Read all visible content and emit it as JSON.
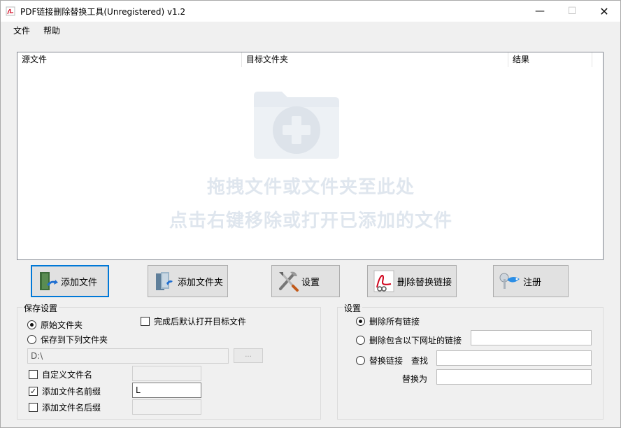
{
  "window": {
    "title": "PDF链接删除替换工具(Unregistered) v1.2",
    "controls": {
      "minimize": "—",
      "maximize": "☐",
      "close": "✕"
    }
  },
  "menu": {
    "file": "文件",
    "help": "帮助"
  },
  "filelist": {
    "columns": {
      "source": "源文件",
      "target": "目标文件夹",
      "result": "结果"
    },
    "hint_line1": "拖拽文件或文件夹至此处",
    "hint_line2": "点击右键移除或打开已添加的文件",
    "drop_icon": "folder-plus-icon"
  },
  "toolbar": {
    "add_file": "添加文件",
    "add_folder": "添加文件夹",
    "settings": "设置",
    "delete_replace": "删除替换链接",
    "register": "注册"
  },
  "save_settings": {
    "title": "保存设置",
    "original_folder": "原始文件夹",
    "original_folder_selected": true,
    "save_to_folder": "保存到下列文件夹",
    "save_to_folder_selected": false,
    "open_after_done": "完成后默认打开目标文件",
    "open_after_done_checked": false,
    "folder_path": "D:\\",
    "browse_label": "...",
    "custom_filename": "自定义文件名",
    "custom_filename_checked": false,
    "custom_filename_value": "",
    "add_prefix": "添加文件名前缀",
    "add_prefix_checked": true,
    "prefix_value": "L",
    "add_suffix": "添加文件名后缀",
    "add_suffix_checked": false,
    "suffix_value": ""
  },
  "link_settings": {
    "title": "设置",
    "delete_all": "删除所有链接",
    "delete_all_selected": true,
    "delete_containing": "删除包含以下网址的链接",
    "delete_containing_selected": false,
    "delete_containing_value": "",
    "replace_links": "替换链接",
    "replace_links_selected": false,
    "find_label": "查找",
    "find_value": "",
    "replace_with_label": "替换为",
    "replace_with_value": ""
  },
  "colors": {
    "accent": "#0078d7",
    "hint_text": "#dfe6ee",
    "window_bg": "#f0f0f0"
  }
}
